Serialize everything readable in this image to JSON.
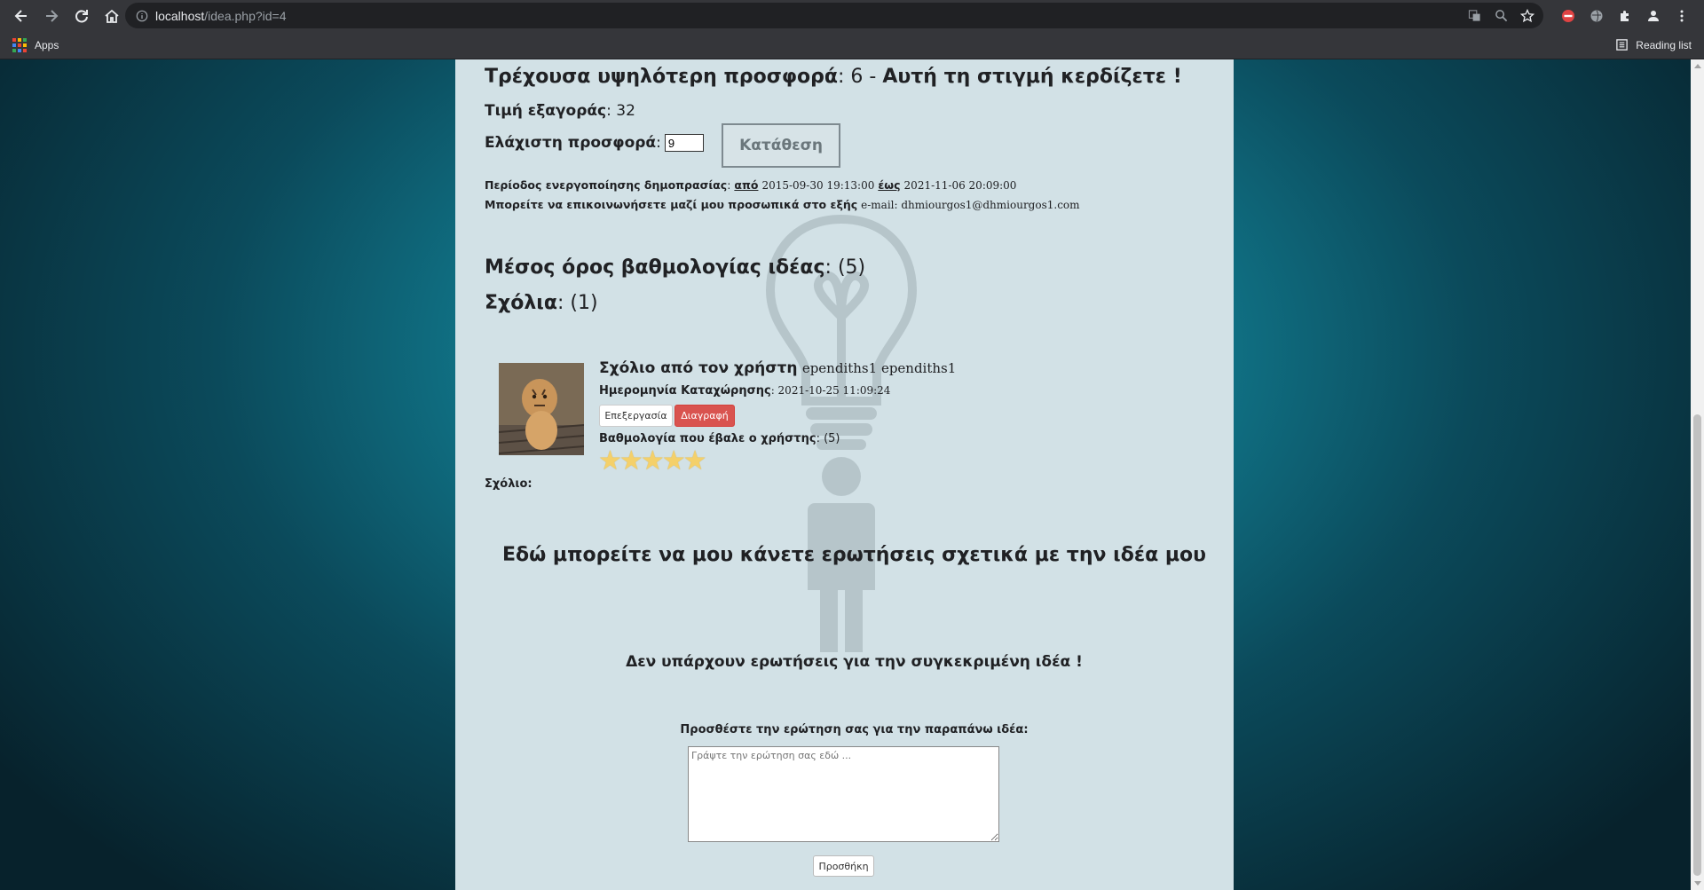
{
  "browser": {
    "url_host": "localhost",
    "url_path": "/idea.php?id=4",
    "bookmarks": {
      "apps_label": "Apps",
      "reading_list_label": "Reading list"
    }
  },
  "auction": {
    "current_bid_label": "Τρέχουσα υψηλότερη προσφορά",
    "current_bid_value": ": 6 - ",
    "winning_text": "Αυτή τη στιγμή κερδίζετε !",
    "buyout_label": "Τιμή εξαγοράς",
    "buyout_value": ": 32",
    "min_bid_label": "Ελάχιστη προσφορά",
    "min_bid_colon": ":",
    "min_bid_value": "9",
    "submit_label": "Κατάθεση",
    "period_label": "Περίοδος ενεργοποίησης δημοπρασίας",
    "period_from_label": "από",
    "period_from": "2015-09-30 19:13:00",
    "period_to_label": "έως",
    "period_to": "2021-11-06 20:09:00",
    "contact_label": "Μπορείτε να επικοινωνήσετε μαζί μου προσωπικά στο εξής",
    "contact_email": "e-mail: dhmiourgos1@dhmiourgos1.com"
  },
  "rating": {
    "avg_label": "Μέσος όρος βαθμολογίας ιδέας",
    "avg_value": ": (5)"
  },
  "comments": {
    "header_label": "Σχόλια",
    "header_count": ": (1)",
    "items": [
      {
        "title_label": "Σχόλιο από τον χρήστη",
        "user": "ependiths1 ependiths1",
        "date_label": "Ημερομηνία Καταχώρησης",
        "date_value": ": 2021-10-25 11:09:24",
        "edit_label": "Επεξεργασία",
        "delete_label": "Διαγραφή",
        "user_rating_label": "Βαθμολογία που έβαλε ο χρήστης",
        "user_rating_value": ": (5)",
        "stars": 5,
        "comment_label": "Σχόλιο:"
      }
    ]
  },
  "questions": {
    "heading": "Εδώ μπορείτε να μου κάνετε ερωτήσεις σχετικά με την ιδέα μου",
    "empty_text": "Δεν υπάρχουν ερωτήσεις για την συγκεκριμένη ιδέα !",
    "add_label": "Προσθέστε την ερώτηση σας για την παραπάνω ιδέα:",
    "textarea_placeholder": "Γράψτε την ερώτηση σας εδώ ...",
    "add_button": "Προσθήκη"
  },
  "colors": {
    "delete_button": "#d9534f",
    "panel_bg": "#d2e1e6",
    "star": "#f4d06a",
    "background_center": "#1aa0b4"
  }
}
